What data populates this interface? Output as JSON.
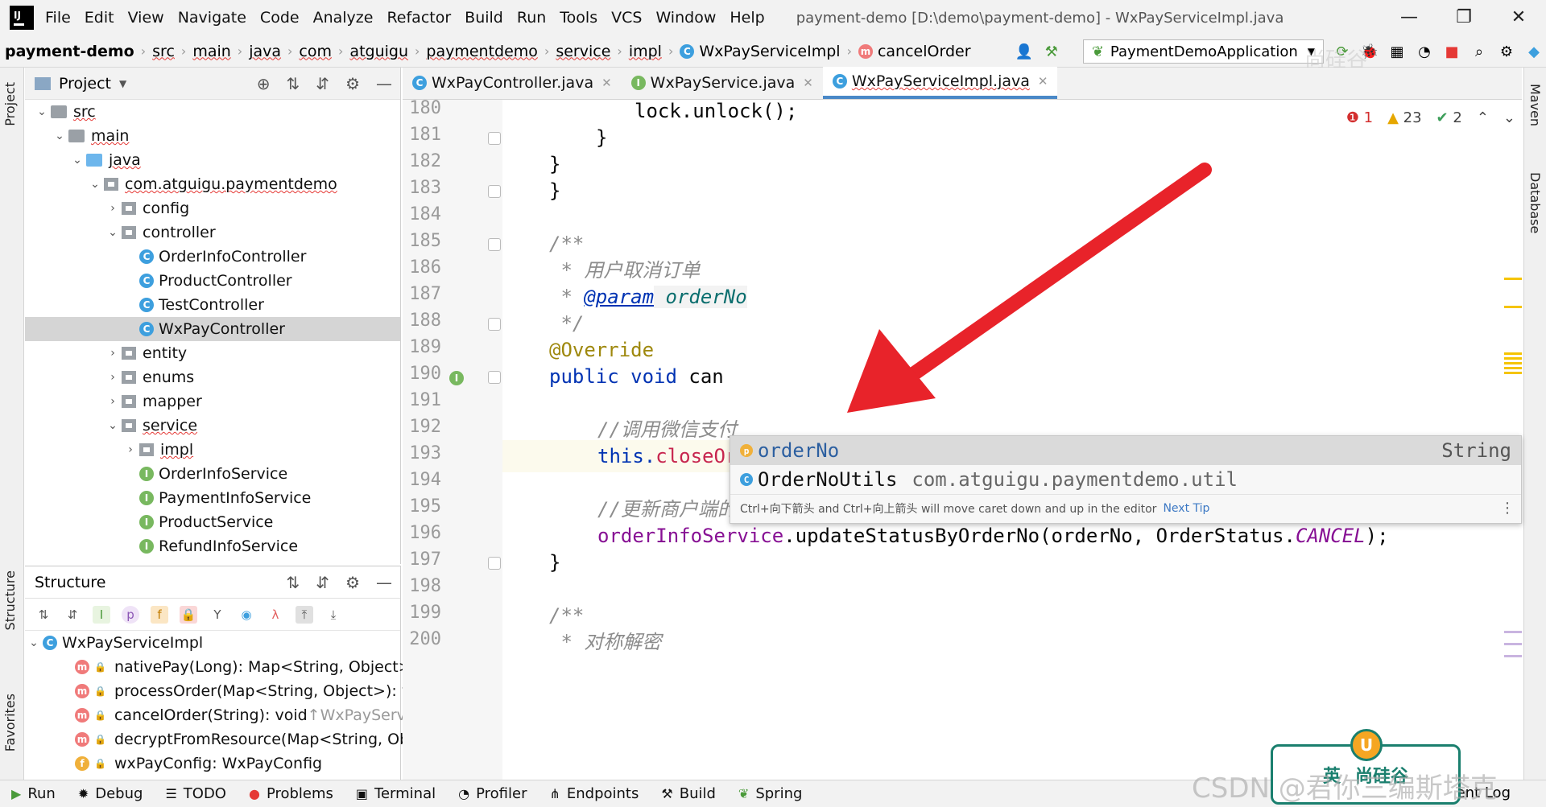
{
  "menu": {
    "items": [
      "File",
      "Edit",
      "View",
      "Navigate",
      "Code",
      "Analyze",
      "Refactor",
      "Build",
      "Run",
      "Tools",
      "VCS",
      "Window",
      "Help"
    ],
    "title": "payment-demo [D:\\demo\\payment-demo] - WxPayServiceImpl.java",
    "min": "—",
    "restore": "❐",
    "close": "✕"
  },
  "breadcrumb": {
    "project": "payment-demo",
    "parts": [
      "src",
      "main",
      "java",
      "com",
      "atguigu",
      "paymentdemo",
      "service",
      "impl"
    ],
    "class_name": "WxPayServiceImpl",
    "method_name": "cancelOrder",
    "run_config": "PaymentDemoApplication"
  },
  "project_panel": {
    "title": "Project",
    "tree": [
      {
        "label": "src",
        "depth": 1,
        "exp": "⌄",
        "kind": "folder"
      },
      {
        "label": "main",
        "depth": 2,
        "exp": "⌄",
        "kind": "folder"
      },
      {
        "label": "java",
        "depth": 3,
        "exp": "⌄",
        "kind": "folder-blue"
      },
      {
        "label": "com.atguigu.paymentdemo",
        "depth": 4,
        "exp": "⌄",
        "kind": "pkg"
      },
      {
        "label": "config",
        "depth": 5,
        "exp": "›",
        "kind": "pkg"
      },
      {
        "label": "controller",
        "depth": 5,
        "exp": "⌄",
        "kind": "pkg"
      },
      {
        "label": "OrderInfoController",
        "depth": 6,
        "exp": "",
        "kind": "c"
      },
      {
        "label": "ProductController",
        "depth": 6,
        "exp": "",
        "kind": "c"
      },
      {
        "label": "TestController",
        "depth": 6,
        "exp": "",
        "kind": "c"
      },
      {
        "label": "WxPayController",
        "depth": 6,
        "exp": "",
        "kind": "c",
        "selected": true
      },
      {
        "label": "entity",
        "depth": 5,
        "exp": "›",
        "kind": "pkg"
      },
      {
        "label": "enums",
        "depth": 5,
        "exp": "›",
        "kind": "pkg"
      },
      {
        "label": "mapper",
        "depth": 5,
        "exp": "›",
        "kind": "pkg"
      },
      {
        "label": "service",
        "depth": 5,
        "exp": "⌄",
        "kind": "pkg"
      },
      {
        "label": "impl",
        "depth": 6,
        "exp": "›",
        "kind": "pkg"
      },
      {
        "label": "OrderInfoService",
        "depth": 6,
        "exp": "",
        "kind": "i"
      },
      {
        "label": "PaymentInfoService",
        "depth": 6,
        "exp": "",
        "kind": "i"
      },
      {
        "label": "ProductService",
        "depth": 6,
        "exp": "",
        "kind": "i"
      },
      {
        "label": "RefundInfoService",
        "depth": 6,
        "exp": "",
        "kind": "i"
      }
    ]
  },
  "structure_panel": {
    "title": "Structure",
    "root": "WxPayServiceImpl",
    "members": [
      {
        "sig": "nativePay(Long): Map<String, Object>",
        "suffix": " ↑",
        "kind": "m"
      },
      {
        "sig": "processOrder(Map<String, Object>): vo",
        "suffix": "",
        "kind": "m"
      },
      {
        "sig": "cancelOrder(String): void",
        "suffix": " ↑WxPayService",
        "kind": "m"
      },
      {
        "sig": "decryptFromResource(Map<String, Obje",
        "suffix": "",
        "kind": "m"
      },
      {
        "sig": "wxPayConfig: WxPayConfig",
        "suffix": "",
        "kind": "f"
      }
    ]
  },
  "sidebar_labels": {
    "project": "Project",
    "structure": "Structure",
    "favorites": "Favorites",
    "maven": "Maven",
    "database": "Database"
  },
  "tabs": [
    {
      "label": "WxPayController.java",
      "kind": "c",
      "active": false
    },
    {
      "label": "WxPayService.java",
      "kind": "i",
      "active": false
    },
    {
      "label": "WxPayServiceImpl.java",
      "kind": "c",
      "active": true
    }
  ],
  "inspection": {
    "errors": "1",
    "warnings": "23",
    "weak": "2"
  },
  "code": {
    "line_numbers": [
      "180",
      "181",
      "182",
      "183",
      "184",
      "185",
      "186",
      "187",
      "188",
      "189",
      "190",
      "191",
      "192",
      "193",
      "194",
      "195",
      "196",
      "197",
      "198",
      "199",
      "200"
    ],
    "l180": "lock.unlock();",
    "l181": "}",
    "l182": "}",
    "l183": "}",
    "l185": "/**",
    "l186a": " * ",
    "l186b": "用户取消订单",
    "l187a": " * ",
    "l187b": "@param",
    "l187c": " orderNo",
    "l188": " */",
    "l189": "@Override",
    "l190a": "public",
    "l190b": " void ",
    "l190c": "can",
    "l192": "//调用微信支付",
    "l193a": "this.",
    "l193b": "closeOrder",
    "l193c": "(",
    "l193d": "orderNo",
    "l193e": ")",
    "l193f": ";",
    "l195": "//更新商户端的订单状态",
    "l196a": "orderInfoService",
    "l196b": ".updateStatusByOrderNo(orderNo, OrderStatus.",
    "l196c": "CANCEL",
    "l196d": ");",
    "l197": "}",
    "l199": "/**",
    "l200a": " * ",
    "l200b": "对称解密"
  },
  "completion": {
    "item1_name": "orderNo",
    "item1_type": "String",
    "item2_name": "OrderNoUtils",
    "item2_pkg": "com.atguigu.paymentdemo.util",
    "hint": "Ctrl+向下箭头 and Ctrl+向上箭头 will move caret down and up in the editor",
    "next_tip": "Next Tip"
  },
  "bottom_tools": [
    {
      "label": "Run",
      "icon": "▶"
    },
    {
      "label": "Debug",
      "icon": "✹"
    },
    {
      "label": "TODO",
      "icon": "☰"
    },
    {
      "label": "Problems",
      "icon": "●"
    },
    {
      "label": "Terminal",
      "icon": "▣"
    },
    {
      "label": "Profiler",
      "icon": "◔"
    },
    {
      "label": "Endpoints",
      "icon": "⋔"
    },
    {
      "label": "Build",
      "icon": "⚒"
    },
    {
      "label": "Spring",
      "icon": "❦"
    }
  ],
  "bottom_right": "ent Log",
  "overlay": {
    "watermark": "CSDN @君你三编斯塔克",
    "top_watermark": "尚硅谷",
    "ime_a": "英",
    "ime_b": "尚硅谷",
    "ime_u": "U"
  },
  "colors": {
    "accent": "#4a88c7",
    "arrow": "#e8232a",
    "selection": "#d5d5d5"
  }
}
